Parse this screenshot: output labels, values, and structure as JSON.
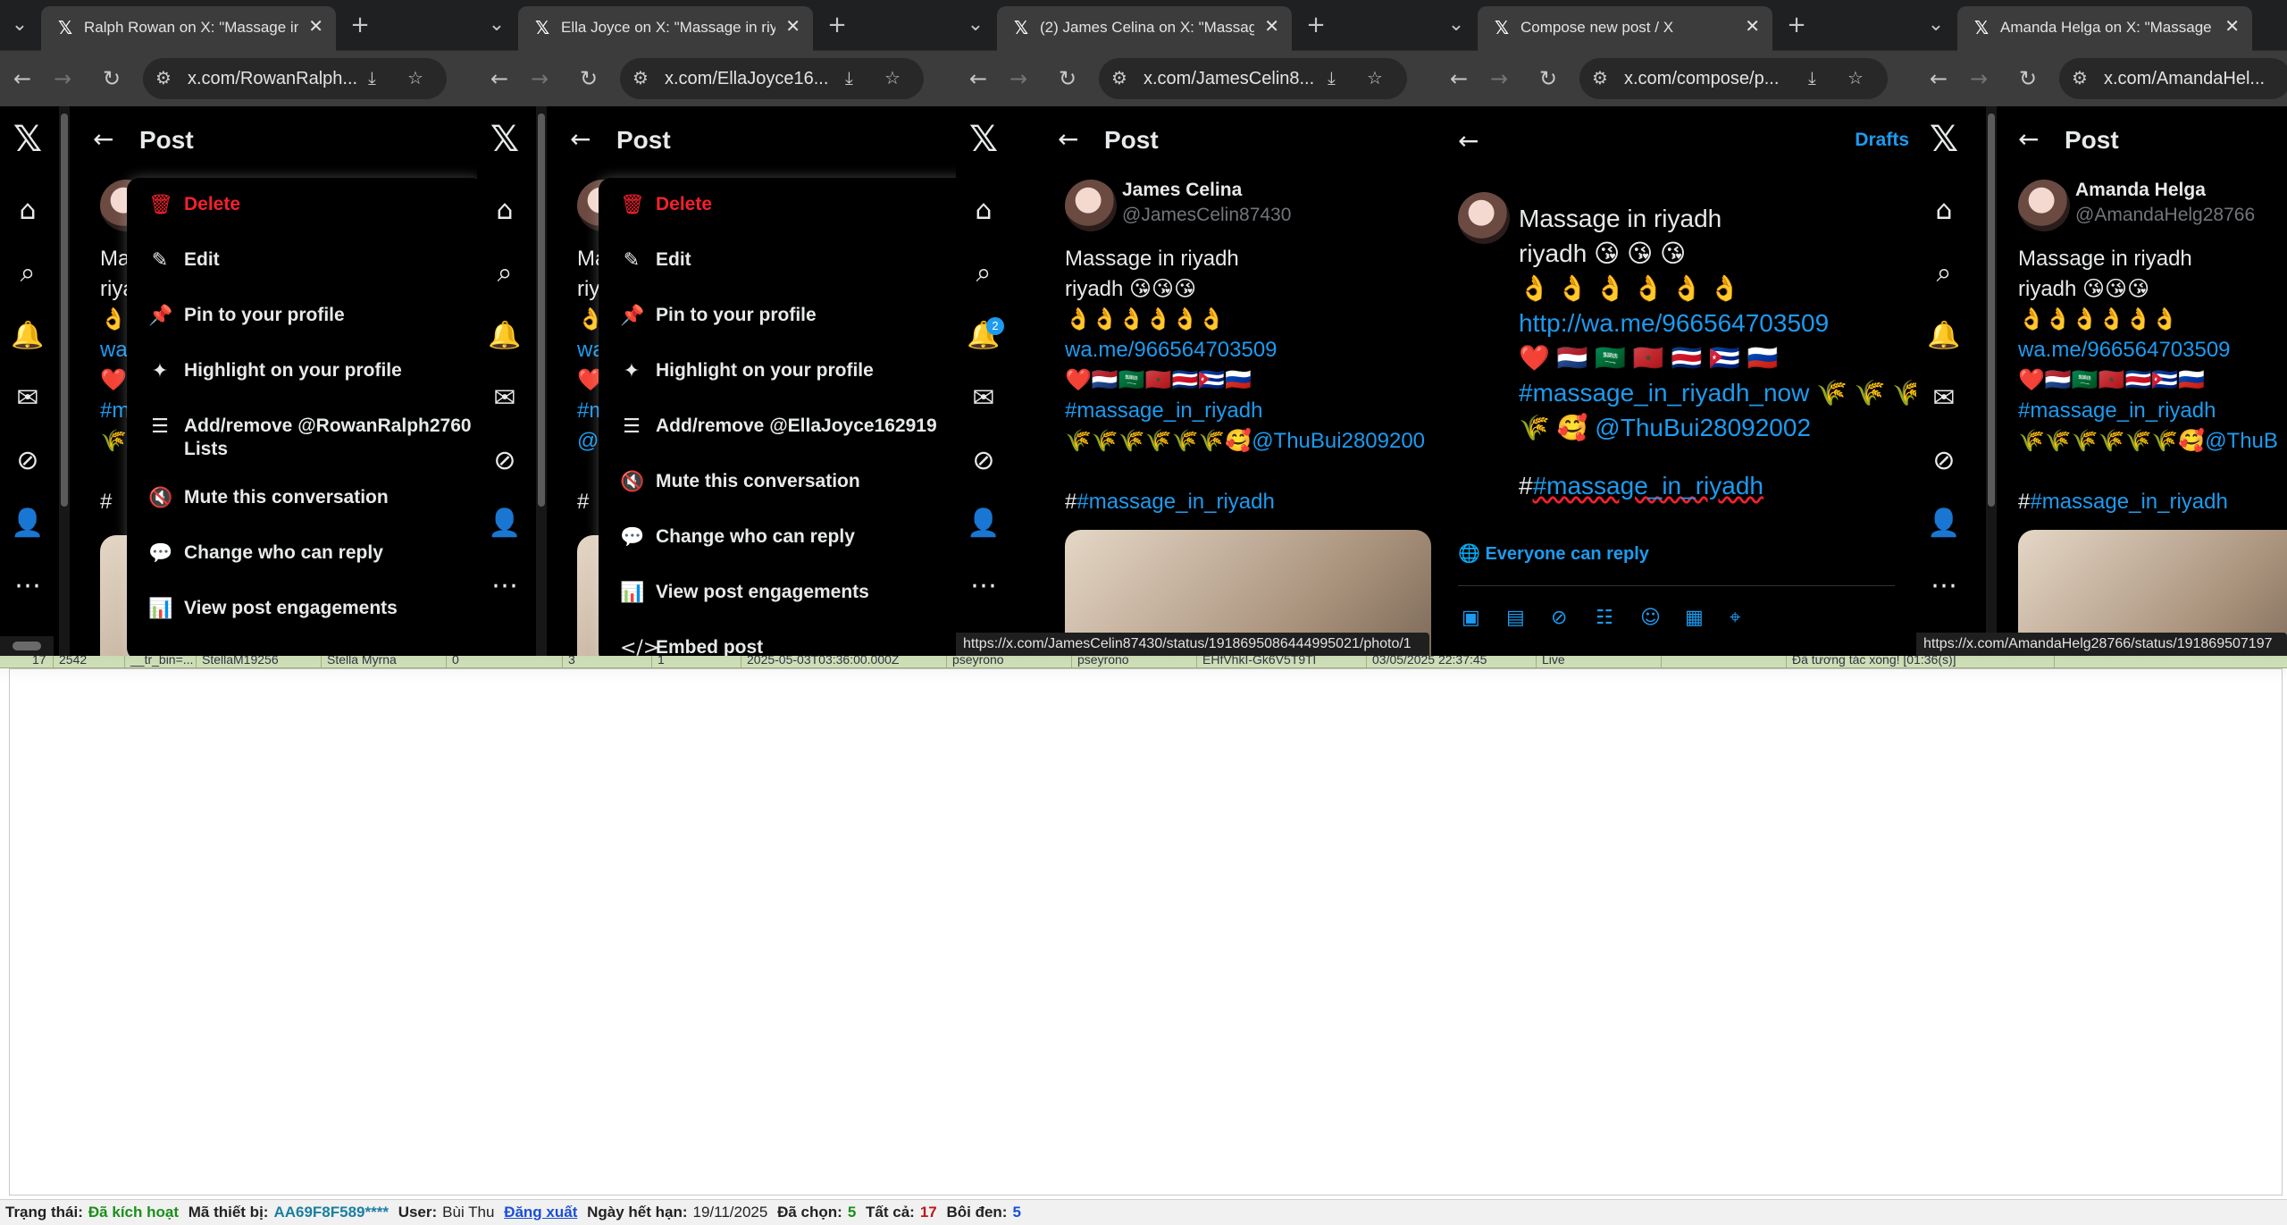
{
  "colors": {
    "x_blue": "#1d9bf0",
    "danger_red": "#f4212e",
    "tab_bg": "#3c3c3c",
    "status_green": "#1a8f1a",
    "status_red": "#c01818"
  },
  "windows": [
    {
      "tab_title": "Ralph Rowan on X: \"Massage in",
      "url": "x.com/RowanRalph...",
      "header_title": "Post",
      "body_lines": [
        "Ma",
        "riya",
        "👌",
        "wa",
        "❤️",
        "#m",
        "🌾"
      ],
      "hashtag_line": "#",
      "menu": [
        {
          "icon": "trash-icon",
          "glyph": "🗑",
          "label": "Delete",
          "danger": true
        },
        {
          "icon": "edit-icon",
          "glyph": "✎",
          "label": "Edit"
        },
        {
          "icon": "pin-icon",
          "glyph": "📌",
          "label": "Pin to your profile"
        },
        {
          "icon": "sparkle-icon",
          "glyph": "✦",
          "label": "Highlight on your profile"
        },
        {
          "icon": "list-add-icon",
          "glyph": "☰",
          "label": "Add/remove @RowanRalph2760",
          "label2": "Lists"
        },
        {
          "icon": "mute-icon",
          "glyph": "🔇",
          "label": "Mute this conversation"
        },
        {
          "icon": "reply-icon",
          "glyph": "💬",
          "label": "Change who can reply"
        },
        {
          "icon": "stats-icon",
          "glyph": "📊",
          "label": "View post engagements"
        }
      ]
    },
    {
      "tab_title": "Ella Joyce on X: \"Massage in riy",
      "url": "x.com/EllaJoyce16...",
      "header_title": "Post",
      "body_lines": [
        "Ma",
        "riya",
        "👌",
        "wa",
        "❤️",
        "#m",
        "@T"
      ],
      "hashtag_line": "#",
      "menu": [
        {
          "icon": "trash-icon",
          "glyph": "🗑",
          "label": "Delete",
          "danger": true
        },
        {
          "icon": "edit-icon",
          "glyph": "✎",
          "label": "Edit"
        },
        {
          "icon": "pin-icon",
          "glyph": "📌",
          "label": "Pin to your profile"
        },
        {
          "icon": "sparkle-icon",
          "glyph": "✦",
          "label": "Highlight on your profile"
        },
        {
          "icon": "list-add-icon",
          "glyph": "☰",
          "label": "Add/remove @EllaJoyce162919"
        },
        {
          "icon": "mute-icon",
          "glyph": "🔇",
          "label": "Mute this conversation"
        },
        {
          "icon": "reply-icon",
          "glyph": "💬",
          "label": "Change who can reply"
        },
        {
          "icon": "stats-icon",
          "glyph": "📊",
          "label": "View post engagements"
        },
        {
          "icon": "embed-icon",
          "glyph": "</>",
          "label": "Embed post"
        }
      ]
    },
    {
      "tab_title": "(2) James Celina on X: \"Massag",
      "url": "x.com/JamesCelin8...",
      "header_title": "Post",
      "author_name": "James Celina",
      "author_handle": "@JamesCelin87430",
      "notif_badge": "2",
      "body_lines": [
        "Massage in riyadh",
        "riyadh 😘😘😘",
        "👌👌👌👌👌👌"
      ],
      "link_url": "wa.me/966564703509",
      "flags": "❤️🇳🇱🇸🇦🇲🇦🇨🇷🇨🇺🇷🇺",
      "hashtag1": "#massage_in_riyadh",
      "wheat_line": "🌾🌾🌾🌾🌾🌾🥰",
      "mention": "@ThuBui2809200",
      "hashtag_prefix": "#",
      "hashtag2": "#massage_in_riyadh",
      "status_url": "https://x.com/JamesCelin87430/status/1918695086444995021/photo/1"
    },
    {
      "tab_title": "Compose new post / X",
      "url": "x.com/compose/p...",
      "drafts": "Drafts",
      "lines": [
        "Massage in riyadh",
        "riyadh  😘  😘  😘",
        " 👌  👌  👌  👌  👌  👌"
      ],
      "link": "http://wa.me/966564703509",
      "flags": " ❤️ 🇳🇱 🇸🇦 🇲🇦 🇨🇷 🇨🇺 🇷🇺",
      "hashtag_now": "#massage_in_riyadh_now",
      "wheat_after": "  🌾   🌾   🌾",
      "wheat2": " 🌾  🥰",
      "mention": "@ThuBui28092002",
      "hash_prefix": "#",
      "hashtag": "#massage_in_riyadh",
      "reply_setting": "Everyone can reply"
    },
    {
      "tab_title": "Amanda Helga on X: \"Massage",
      "url": "x.com/AmandaHel...",
      "header_title": "Post",
      "author_name": "Amanda Helga",
      "author_handle": "@AmandaHelg28766",
      "body_lines": [
        "Massage in riyadh",
        "riyadh 😘😘😘",
        "👌👌👌👌👌👌"
      ],
      "link_url": "wa.me/966564703509",
      "flags": "❤️🇳🇱🇸🇦🇲🇦🇨🇷🇨🇺🇷🇺",
      "hashtag1": "#massage_in_riyadh",
      "wheat_line": "🌾🌾🌾🌾🌾🌾🥰",
      "mention": "@ThuB",
      "hashtag_prefix": "#",
      "hashtag2": "#massage_in_riyadh",
      "status_url": "https://x.com/AmandaHelg28766/status/191869507197"
    }
  ],
  "grid_row": [
    "17",
    "2542",
    "__tr_bin=...",
    "StellaM19256",
    "Stella Myrna",
    "0",
    "3",
    "1",
    "2025-05-03T03:36:00.000Z",
    "pseyrono",
    "pseyrono",
    "EHfVhkI-Gk6V5T9Tl",
    "03/05/2025 22:37:45",
    "Live",
    "",
    "Đã tương tác xong! [01:36(s)]"
  ],
  "statusbar": {
    "state_label": "Trạng thái:",
    "state_value": "Đã kích hoạt",
    "device_label": "Mã thiết bị:",
    "device_value": "AA69F8F589****",
    "user_label": "User:",
    "user_value": "Bùi Thu",
    "logout": "Đăng xuất",
    "expiry_label": "Ngày hết hạn:",
    "expiry_value": "19/11/2025",
    "selected_label": "Đã chọn:",
    "selected_value": "5",
    "total_label": "Tất cả:",
    "total_value": "17",
    "highlight_label": "Bôi đen:",
    "highlight_value": "5"
  }
}
